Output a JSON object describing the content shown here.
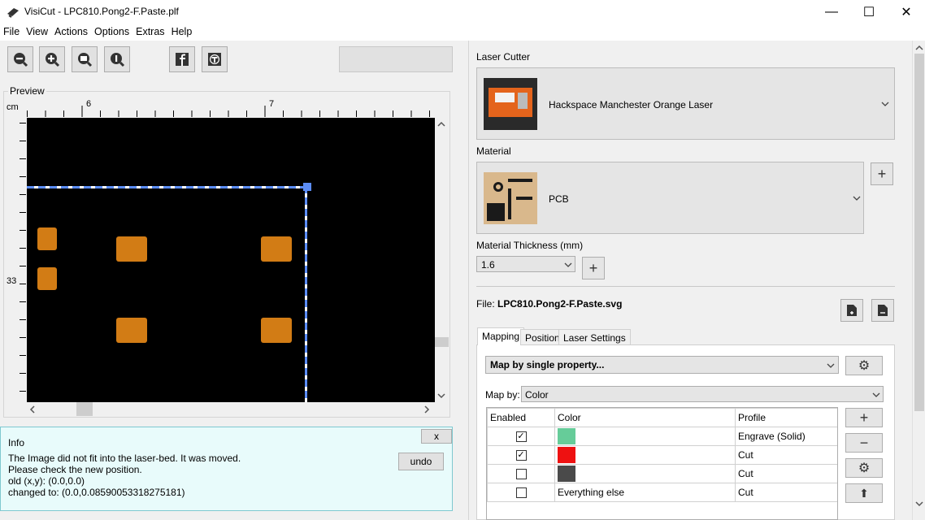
{
  "window": {
    "title": "VisiCut - LPC810.Pong2-F.Paste.plf",
    "minimize_glyph": "—",
    "maximize_glyph": "☐",
    "close_glyph": "✕"
  },
  "menu": [
    "File",
    "View",
    "Actions",
    "Options",
    "Extras",
    "Help"
  ],
  "toolbar": {
    "icons": [
      "zoom-out-icon",
      "zoom-in-icon",
      "zoom-fit-icon",
      "zoom-reset-icon",
      "facebook-icon",
      "thingiverse-icon"
    ]
  },
  "preview": {
    "label": "Preview",
    "unit": "cm",
    "ruler_top": [
      "6",
      "7"
    ],
    "ruler_left": [
      "33"
    ]
  },
  "info": {
    "title": "Info",
    "close_label": "x",
    "lines": [
      "The Image did not fit into the laser-bed. It was moved.",
      "Please check the new position.",
      "old (x,y): (0.0,0.0)",
      "changed to: (0.0,0.08590053318275181)"
    ],
    "undo_label": "undo"
  },
  "laser_cutter": {
    "label": "Laser Cutter",
    "value": "Hackspace Manchester Orange Laser"
  },
  "material": {
    "label": "Material",
    "value": "PCB"
  },
  "thickness": {
    "label": "Material Thickness (mm)",
    "value": "1.6"
  },
  "file": {
    "label": "File:",
    "name": "LPC810.Pong2-F.Paste.svg"
  },
  "tabs": [
    "Mapping",
    "Position",
    "Laser Settings"
  ],
  "mapping": {
    "mode": "Map by single property...",
    "map_by_label": "Map by:",
    "map_by_value": "Color",
    "columns": [
      "Enabled",
      "Color",
      "Profile"
    ],
    "rows": [
      {
        "enabled": true,
        "color": "#66cc99",
        "label": "",
        "profile": "Engrave (Solid)"
      },
      {
        "enabled": true,
        "color": "#ee1111",
        "label": "",
        "profile": "Cut"
      },
      {
        "enabled": false,
        "color": "#4a4a4a",
        "label": "",
        "profile": "Cut"
      },
      {
        "enabled": false,
        "color": "",
        "label": "Everything else",
        "profile": "Cut"
      }
    ]
  },
  "colors": {
    "canvas": "#000000",
    "pad": "#d27c15",
    "info_bg": "#e8fbfb",
    "selection": "#5b8cf5"
  }
}
